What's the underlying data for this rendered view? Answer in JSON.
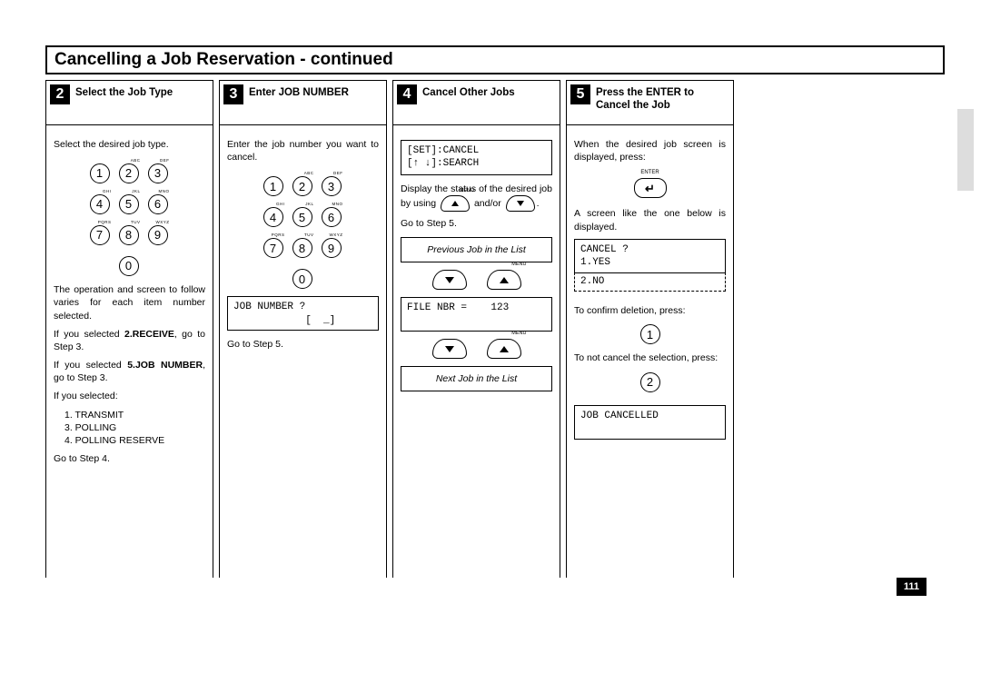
{
  "page_title": "Cancelling a Job Reservation - continued",
  "page_number": "111",
  "keypad_letters": [
    "",
    "ABC",
    "DEF",
    "GHI",
    "JKL",
    "MNO",
    "PQRS",
    "TUV",
    "WXYZ"
  ],
  "step2": {
    "num": "2",
    "title": "Select the Job Type",
    "p1": "Select the desired job type.",
    "p2": "The operation and screen to follow varies for each item number selected.",
    "p3a": "If you selected ",
    "p3b": "2.RECEIVE",
    "p3c": ", go to Step 3.",
    "p4a": "If you selected ",
    "p4b": "5.JOB NUMBER",
    "p4c": ", go to Step 3.",
    "p5": "If you selected:",
    "list": [
      "1. TRANSMIT",
      "3. POLLING",
      "4. POLLING RESERVE"
    ],
    "p6": "Go to Step 4."
  },
  "step3": {
    "num": "3",
    "title": "Enter JOB NUMBER",
    "p1": "Enter the job number you want to cancel.",
    "display": "JOB NUMBER ?\n            [  _]",
    "p2": "Go to Step 5."
  },
  "step4": {
    "num": "4",
    "title": "Cancel Other Jobs",
    "display1": "[SET]:CANCEL\n[↑ ↓]:SEARCH",
    "p1a": "Display the status of the desired job by using ",
    "p1b": " and/or ",
    "p1c": ".",
    "p2": "Go to Step 5.",
    "prev_label": "Previous Job in the List",
    "display2": "FILE NBR =    123",
    "next_label": "Next Job in the List",
    "menu_label": "MENU"
  },
  "step5": {
    "num": "5",
    "title": "Press the ENTER to Cancel the Job",
    "p1": "When the desired job screen is displayed, press:",
    "enter_label": "ENTER",
    "enter_symbol": "↵",
    "p2": "A screen like the one below is displayed.",
    "display1": "CANCEL ?\n1.YES",
    "display1b": "2.NO",
    "p3": "To confirm deletion, press:",
    "key1": "1",
    "p4": "To not cancel the selection, press:",
    "key2": "2",
    "display2": "JOB CANCELLED\n "
  }
}
